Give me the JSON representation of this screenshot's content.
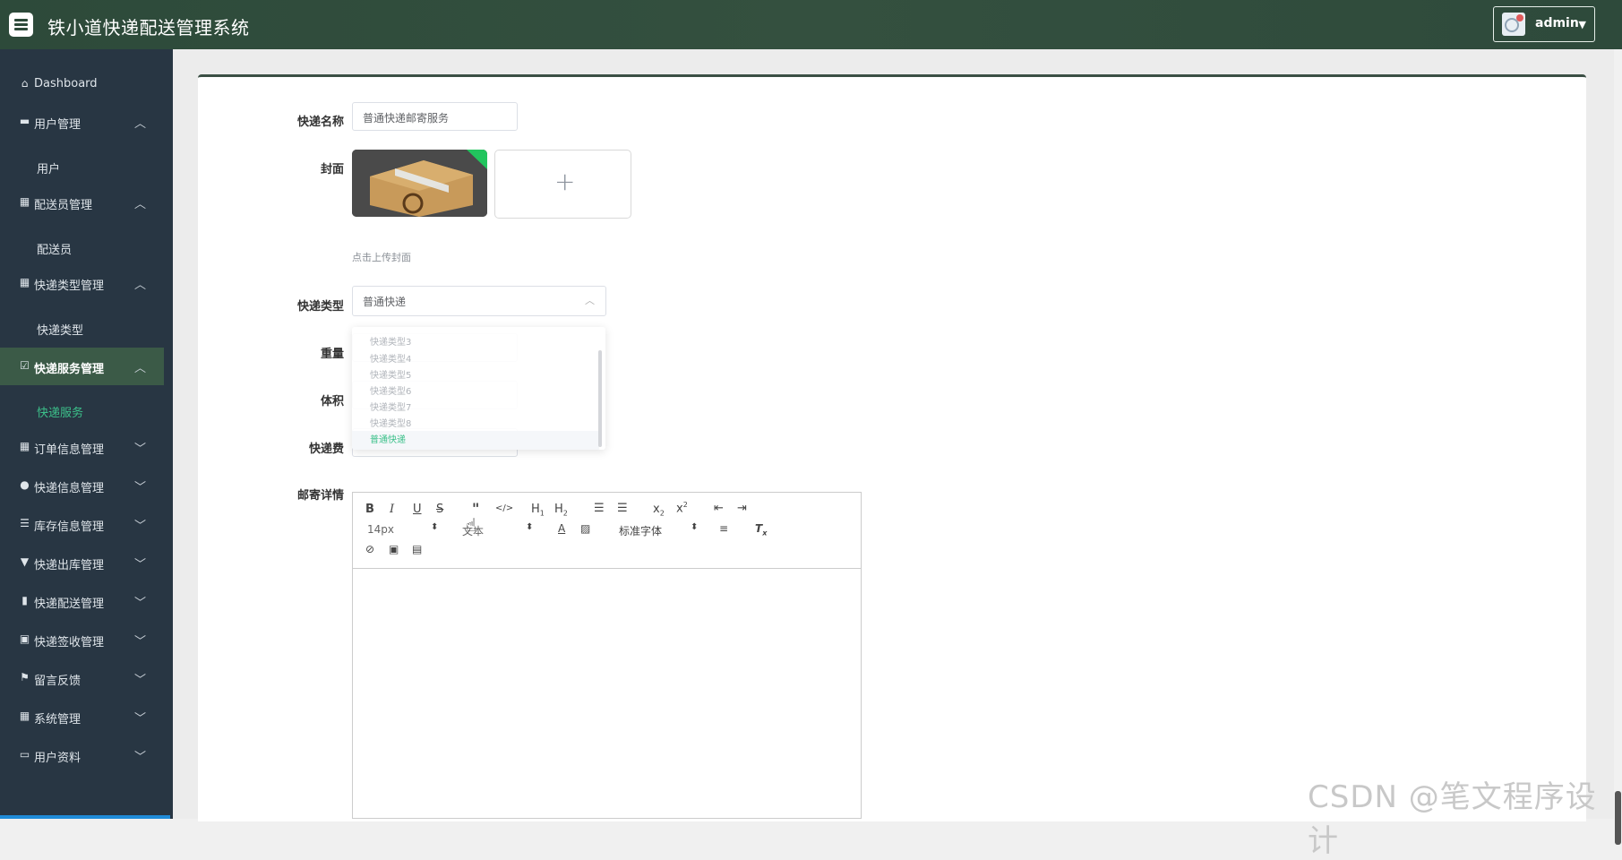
{
  "header": {
    "title": "铁小道快递配送管理系统",
    "user": "admin"
  },
  "sidebar": {
    "items": [
      {
        "label": "Dashboard",
        "icon": "home-icon"
      },
      {
        "label": "用户管理",
        "icon": "ticket-icon"
      },
      {
        "label": "配送员管理",
        "icon": "grid-icon"
      },
      {
        "label": "快递类型管理",
        "icon": "grid-icon"
      },
      {
        "label": "快递服务管理",
        "icon": "check-square-icon"
      },
      {
        "label": "订单信息管理",
        "icon": "grid-icon"
      },
      {
        "label": "快递信息管理",
        "icon": "user-icon"
      },
      {
        "label": "库存信息管理",
        "icon": "list-icon"
      },
      {
        "label": "快递出库管理",
        "icon": "truck-icon"
      },
      {
        "label": "快递配送管理",
        "icon": "bar-chart-icon"
      },
      {
        "label": "快递签收管理",
        "icon": "clipboard-icon"
      },
      {
        "label": "留言反馈",
        "icon": "flag-icon"
      },
      {
        "label": "系统管理",
        "icon": "grid-icon"
      },
      {
        "label": "用户资料",
        "icon": "card-icon"
      }
    ],
    "subs": {
      "user": "用户",
      "courier": "配送员",
      "type": "快递类型",
      "service": "快递服务"
    }
  },
  "form": {
    "name_label": "快递名称",
    "name_value": "普通快递邮寄服务",
    "cover_label": "封面",
    "cover_hint": "点击上传封面",
    "type_label": "快递类型",
    "type_value": "普通快递",
    "weight_label": "重量",
    "volume_label": "体积",
    "fee_label": "快递费",
    "detail_label": "邮寄详情",
    "dropdown_options": [
      "快递类型3",
      "快递类型4",
      "快递类型5",
      "快递类型6",
      "快递类型7",
      "快递类型8",
      "普通快递"
    ],
    "editor": {
      "font_size": "14px",
      "font_family": "标准字体",
      "text_style": "文本"
    }
  },
  "watermark": "CSDN @笔文程序设计",
  "colors": {
    "header": "#2d4a3a",
    "sidebar": "#283643",
    "active": "#3b5a47",
    "accent": "#3cc08a"
  }
}
